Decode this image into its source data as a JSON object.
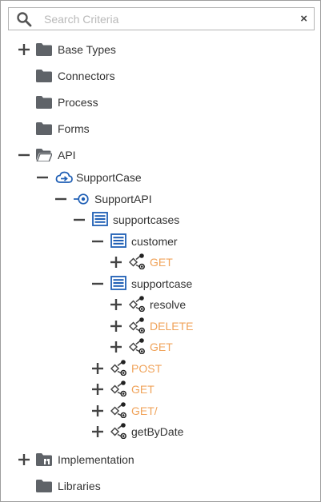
{
  "search": {
    "placeholder": "Search Criteria",
    "value": "",
    "clear_symbol": "×"
  },
  "colors": {
    "accent_blue": "#1f5fb5",
    "method_orange": "#f0a35a",
    "folder_gray": "#5f6368"
  },
  "tree": {
    "base_types": "Base Types",
    "connectors": "Connectors",
    "process": "Process",
    "forms": "Forms",
    "api": "API",
    "support_case": "SupportCase",
    "support_api": "SupportAPI",
    "supportcases": "supportcases",
    "customer": "customer",
    "customer_get": "GET",
    "supportcase": "supportcase",
    "resolve": "resolve",
    "delete": "DELETE",
    "supportcase_get": "GET",
    "post": "POST",
    "get": "GET",
    "get_slash": "GET/",
    "get_by_date": "getByDate",
    "implementation": "Implementation",
    "libraries": "Libraries"
  }
}
